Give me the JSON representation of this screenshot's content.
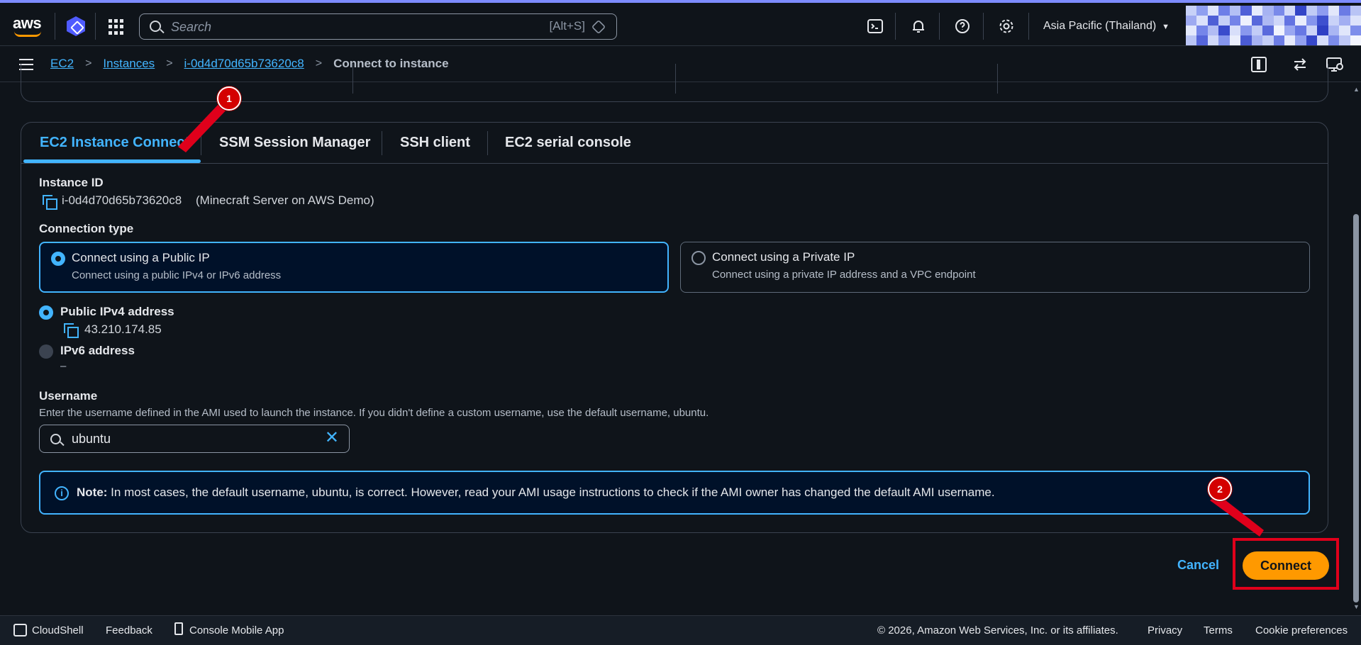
{
  "topbar": {
    "logo": "aws",
    "search_placeholder": "Search",
    "search_shortcut": "[Alt+S]",
    "region": "Asia Pacific (Thailand)",
    "icons": [
      "cloudshell-icon",
      "bell-icon",
      "help-icon",
      "settings-icon"
    ]
  },
  "breadcrumb": {
    "items": [
      "EC2",
      "Instances",
      "i-0d4d70d65b73620c8"
    ],
    "current": "Connect to instance"
  },
  "tabs": [
    "EC2 Instance Connect",
    "SSM Session Manager",
    "SSH client",
    "EC2 serial console"
  ],
  "instance": {
    "label": "Instance ID",
    "id": "i-0d4d70d65b73620c8",
    "name": "(Minecraft Server on AWS Demo)"
  },
  "connection_type": {
    "label": "Connection type",
    "public": {
      "title": "Connect using a Public IP",
      "desc": "Connect using a public IPv4 or IPv6 address"
    },
    "private": {
      "title": "Connect using a Private IP",
      "desc": "Connect using a private IP address and a VPC endpoint"
    }
  },
  "addresses": {
    "ipv4_label": "Public IPv4 address",
    "ipv4_value": "43.210.174.85",
    "ipv6_label": "IPv6 address",
    "ipv6_value": "–"
  },
  "username": {
    "label": "Username",
    "help": "Enter the username defined in the AMI used to launch the instance. If you didn't define a custom username, use the default username, ubuntu.",
    "value": "ubuntu"
  },
  "note": {
    "bold": "Note:",
    "text": " In most cases, the default username, ubuntu, is correct. However, read your AMI usage instructions to check if the AMI owner has changed the default AMI username."
  },
  "actions": {
    "cancel": "Cancel",
    "connect": "Connect"
  },
  "annotations": {
    "step1": "1",
    "step2": "2"
  },
  "footer": {
    "cloudshell": "CloudShell",
    "feedback": "Feedback",
    "mobile": "Console Mobile App",
    "copyright": "© 2026, Amazon Web Services, Inc. or its affiliates.",
    "privacy": "Privacy",
    "terms": "Terms",
    "cookies": "Cookie preferences"
  },
  "colors": {
    "accent": "#42b4ff",
    "primary_button": "#ff9900",
    "annotation": "#e0001b",
    "background": "#0f141a"
  }
}
